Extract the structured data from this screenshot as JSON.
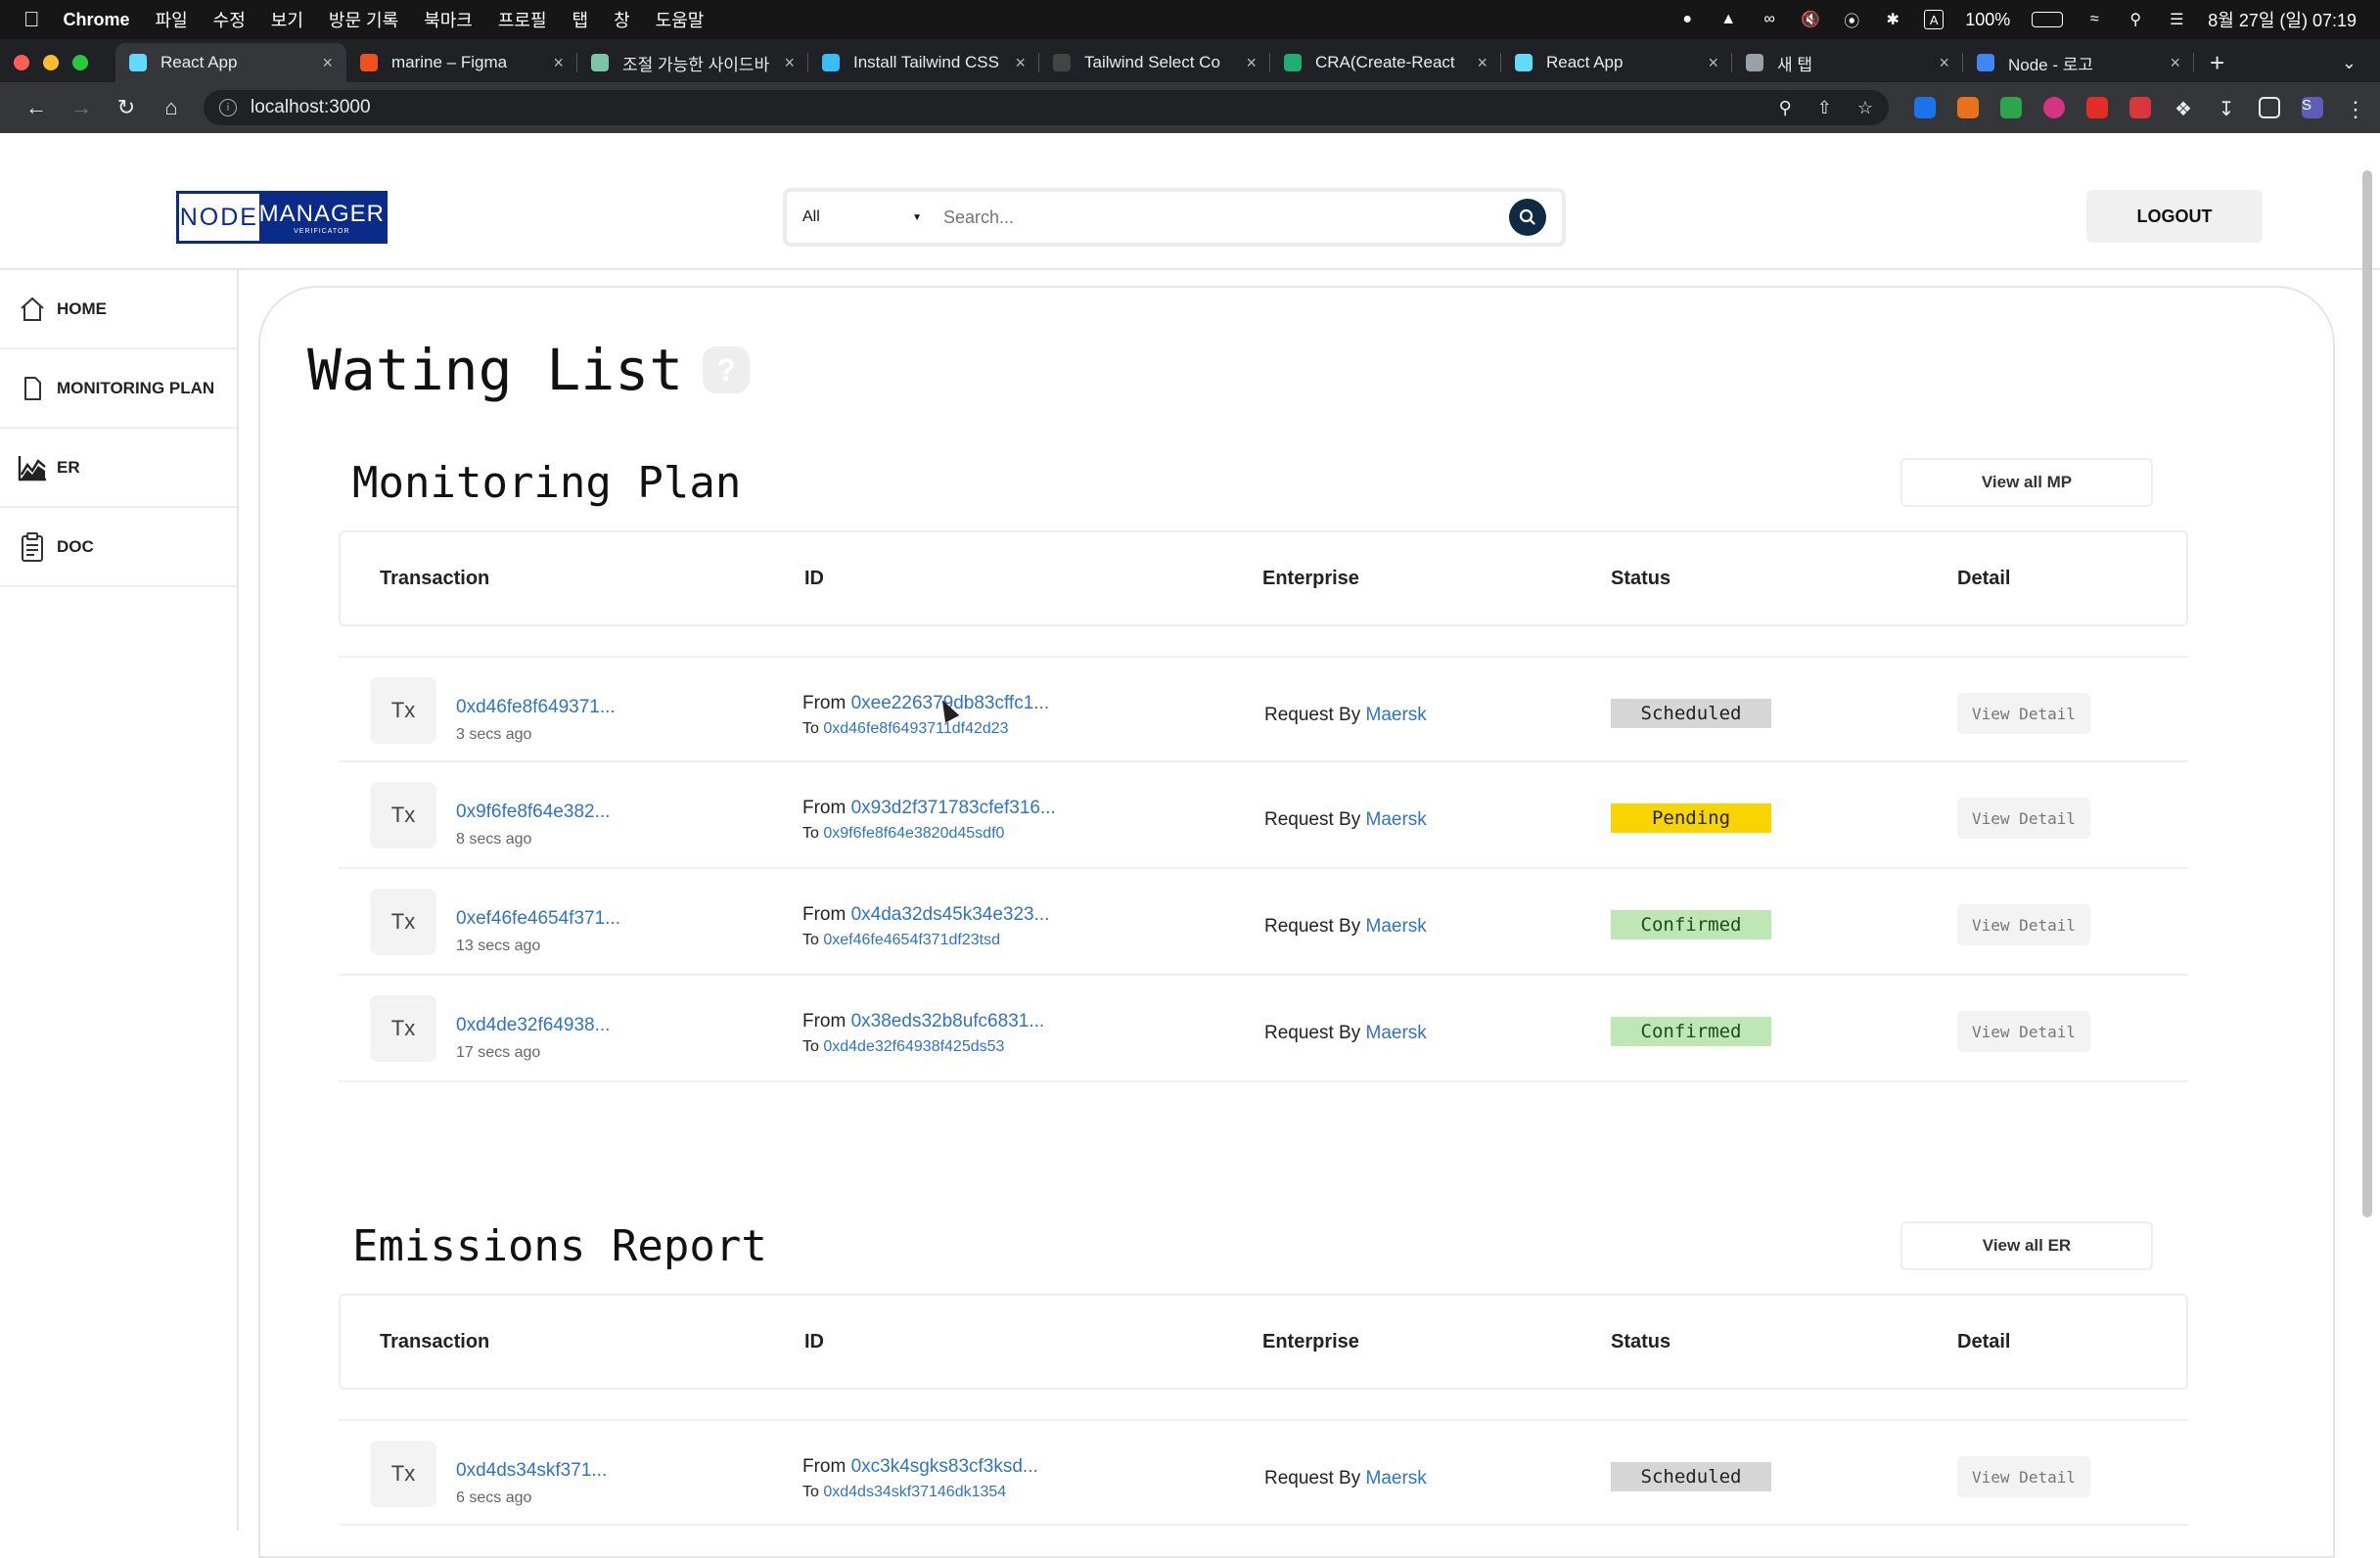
{
  "os_menubar": {
    "app": "Chrome",
    "items": [
      "파일",
      "수정",
      "보기",
      "방문 기록",
      "북마크",
      "프로필",
      "탭",
      "창",
      "도움말"
    ],
    "battery": "100%",
    "datetime": "8월 27일 (일) 07:19"
  },
  "browser": {
    "tabs": [
      {
        "title": "React App",
        "favicon_color": "#61dafb",
        "active": true
      },
      {
        "title": "marine – Figma",
        "favicon_color": "#f24e1e",
        "active": false
      },
      {
        "title": "조절 가능한 사이드바",
        "favicon_color": "#7fc4a6",
        "active": false
      },
      {
        "title": "Install Tailwind CSS",
        "favicon_color": "#38bdf8",
        "active": false
      },
      {
        "title": "Tailwind Select Co",
        "favicon_color": "#444444",
        "active": false
      },
      {
        "title": "CRA(Create-React",
        "favicon_color": "#1fad73",
        "active": false
      },
      {
        "title": "React App",
        "favicon_color": "#61dafb",
        "active": false
      },
      {
        "title": "새 탭",
        "favicon_color": "#9aa0a6",
        "active": false
      },
      {
        "title": "Node - 로고",
        "favicon_color": "#4285f4",
        "active": false
      }
    ],
    "url": "localhost:3000",
    "profile_initial": "S"
  },
  "header": {
    "logo_left": "NODE",
    "logo_right": "MANAGER",
    "logo_sub": "VERIFICATOR",
    "search": {
      "category": "All",
      "placeholder": "Search..."
    },
    "logout_label": "LOGOUT"
  },
  "sidebar": {
    "items": [
      {
        "label": "HOME",
        "icon": "home-icon"
      },
      {
        "label": "MONITORING PLAN",
        "icon": "document-icon"
      },
      {
        "label": "ER",
        "icon": "chart-icon"
      },
      {
        "label": "DOC",
        "icon": "clipboard-icon"
      }
    ]
  },
  "page": {
    "title": "Wating List",
    "help": "?"
  },
  "table_headers": [
    "Transaction",
    "ID",
    "Enterprise",
    "Status",
    "Detail"
  ],
  "monitoring_plan": {
    "title": "Monitoring Plan",
    "view_all": "View all MP",
    "rows": [
      {
        "tx": "Tx",
        "hash": "0xd46fe8f649371...",
        "age": "3 secs ago",
        "from": "0xee226379db83cffc1...",
        "to": "0xd46fe8f6493711df42d23",
        "request_by": "Request By",
        "enterprise": "Maersk",
        "status": "Scheduled",
        "detail": "View Detail"
      },
      {
        "tx": "Tx",
        "hash": "0x9f6fe8f64e382...",
        "age": "8 secs ago",
        "from": "0x93d2f371783cfef316...",
        "to": "0x9f6fe8f64e3820d45sdf0",
        "request_by": "Request By",
        "enterprise": "Maersk",
        "status": "Pending",
        "detail": "View Detail"
      },
      {
        "tx": "Tx",
        "hash": "0xef46fe4654f371...",
        "age": "13 secs ago",
        "from": "0x4da32ds45k34e323...",
        "to": "0xef46fe4654f371df23tsd",
        "request_by": "Request By",
        "enterprise": "Maersk",
        "status": "Confirmed",
        "detail": "View Detail"
      },
      {
        "tx": "Tx",
        "hash": "0xd4de32f64938...",
        "age": "17 secs ago",
        "from": "0x38eds32b8ufc6831...",
        "to": "0xd4de32f64938f425ds53",
        "request_by": "Request By",
        "enterprise": "Maersk",
        "status": "Confirmed",
        "detail": "View Detail"
      }
    ]
  },
  "emissions_report": {
    "title": "Emissions Report",
    "view_all": "View all ER",
    "rows": [
      {
        "tx": "Tx",
        "hash": "0xd4ds34skf371...",
        "age": "6 secs ago",
        "from": "0xc3k4sgks83cf3ksd...",
        "to": "0xd4ds34skf37146dk1354",
        "request_by": "Request By",
        "enterprise": "Maersk",
        "status": "Scheduled",
        "detail": "View Detail"
      }
    ]
  },
  "labels": {
    "from": "From",
    "to": "To"
  },
  "colors": {
    "link": "#2f74c0",
    "pending": "#f8d400",
    "confirmed": "#bfe6b5",
    "scheduled": "#d6d6d6",
    "logo_blue": "#0a2b88"
  }
}
